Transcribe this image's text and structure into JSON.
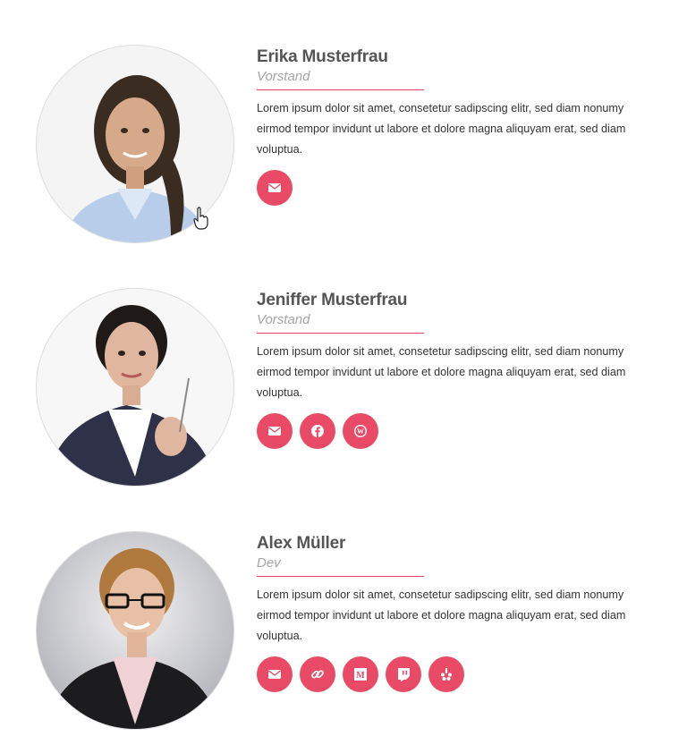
{
  "accent": "#e94b66",
  "team": [
    {
      "name": "Erika Musterfrau",
      "role": "Vorstand",
      "bio": "Lorem ipsum dolor sit amet, consetetur sadipscing elitr, sed diam nonumy eirmod tempor invidunt ut labore et dolore magna aliquyam erat, sed diam voluptua.",
      "socials": [
        "envelope-icon"
      ]
    },
    {
      "name": "Jeniffer Musterfrau",
      "role": "Vorstand",
      "bio": "Lorem ipsum dolor sit amet, consetetur sadipscing elitr, sed diam nonumy eirmod tempor invidunt ut labore et dolore magna aliquyam erat, sed diam voluptua.",
      "socials": [
        "envelope-icon",
        "facebook-icon",
        "wordpress-icon"
      ]
    },
    {
      "name": "Alex Müller",
      "role": "Dev",
      "bio": "Lorem ipsum dolor sit amet, consetetur sadipscing elitr, sed diam nonumy eirmod tempor invidunt ut labore et dolore magna aliquyam erat, sed diam voluptua.",
      "socials": [
        "envelope-icon",
        "link-icon",
        "medium-icon",
        "twitch-icon",
        "yelp-icon"
      ]
    }
  ]
}
